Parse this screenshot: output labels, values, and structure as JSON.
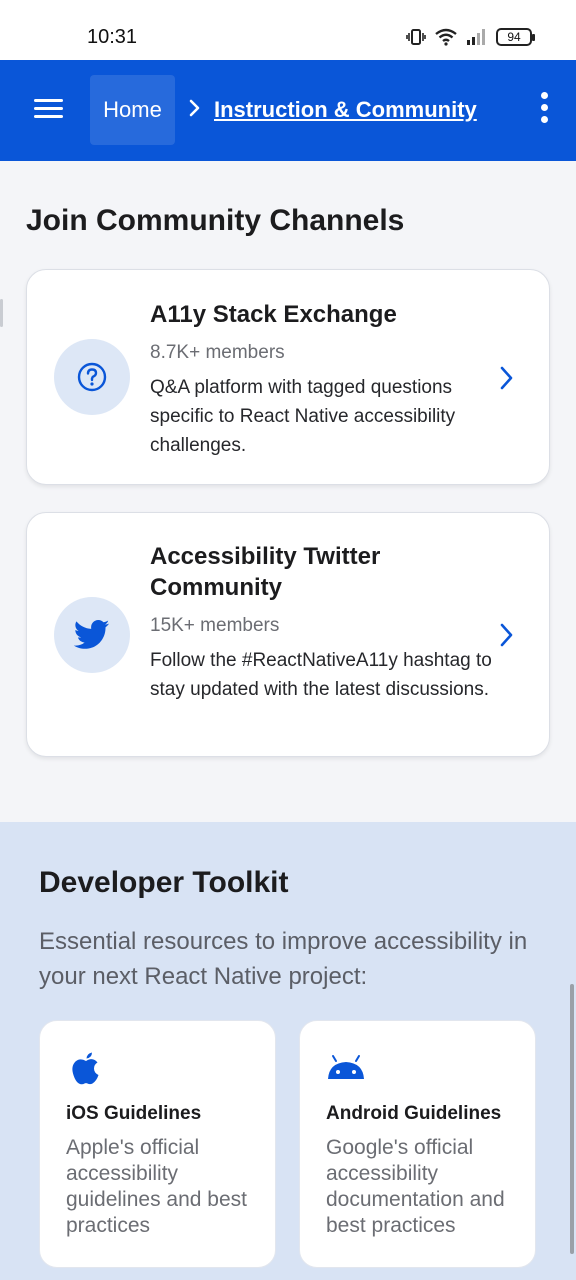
{
  "status_bar": {
    "time": "10:31",
    "battery": "94"
  },
  "app_bar": {
    "home_label": "Home",
    "current_label": "Instruction & Community",
    "background": "#0a56d8"
  },
  "community": {
    "title": "Join Community Channels",
    "cards": [
      {
        "icon": "question-circle-icon",
        "title": "A11y Stack Exchange",
        "members": "8.7K+ members",
        "description": "Q&A platform with tagged questions specific to React Native accessibility challenges."
      },
      {
        "icon": "twitter-bird-icon",
        "title": "Accessibility Twitter Community",
        "members": "15K+ members",
        "description": "Follow the #ReactNativeA11y hashtag to stay updated with the latest discussions."
      }
    ]
  },
  "toolkit": {
    "title": "Developer Toolkit",
    "description": "Essential resources to improve accessibility in your next React Native project:",
    "cards": [
      {
        "icon": "apple-icon",
        "title": "iOS Guidelines",
        "description": "Apple's official accessibility guidelines and best practices"
      },
      {
        "icon": "android-icon",
        "title": "Android Guidelines",
        "description": "Google's official accessibility documentation and best practices"
      }
    ],
    "background": "#d8e3f4"
  },
  "colors": {
    "accent": "#0a56d8",
    "icon_circle": "#dde7f6"
  }
}
